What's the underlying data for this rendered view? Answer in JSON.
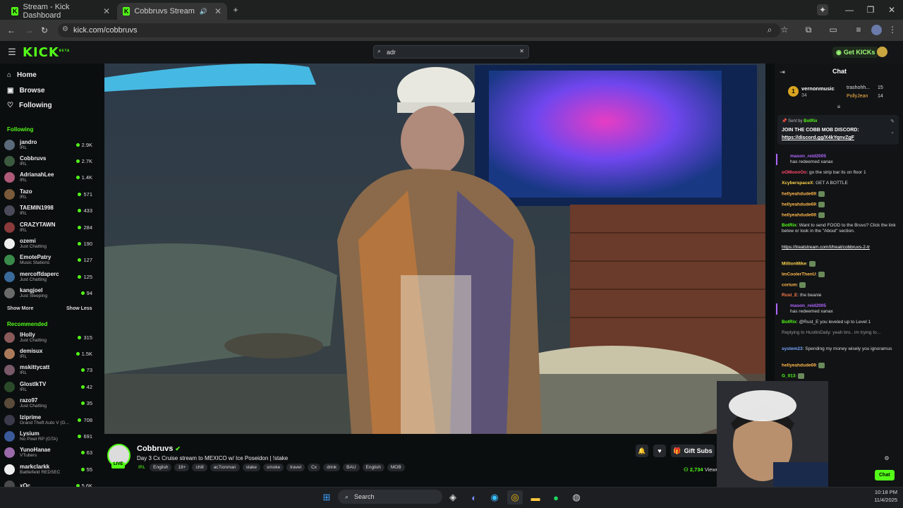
{
  "browser": {
    "tabs": [
      {
        "title": "Stream - Kick Dashboard",
        "active": false
      },
      {
        "title": "Cobbruvs Stream - Watch L",
        "active": true
      }
    ],
    "url": "kick.com/cobbruvs"
  },
  "header": {
    "logo": "KICK",
    "logo_badge": "BETA",
    "search_value": "adr",
    "get_kicks": "Get KICKs"
  },
  "sidebar": {
    "nav": [
      {
        "label": "Home",
        "icon": "home-icon"
      },
      {
        "label": "Browse",
        "icon": "browse-icon"
      },
      {
        "label": "Following",
        "icon": "heart-icon"
      }
    ],
    "following_title": "Following",
    "following": [
      {
        "name": "jandro",
        "category": "IRL",
        "viewers": "2.9K",
        "color": "#5a6a7a"
      },
      {
        "name": "Cobbruvs",
        "category": "IRL",
        "viewers": "2.7K",
        "color": "#3b5a3f"
      },
      {
        "name": "AdrianahLee",
        "category": "IRL",
        "viewers": "1.4K",
        "color": "#b05a7a"
      },
      {
        "name": "Tazo",
        "category": "IRL",
        "viewers": "571",
        "color": "#7a5a3a"
      },
      {
        "name": "TAEMIN1998",
        "category": "IRL",
        "viewers": "433",
        "color": "#4a4a5a"
      },
      {
        "name": "CRAZYTAWN",
        "category": "IRL",
        "viewers": "284",
        "color": "#8a3a3a"
      },
      {
        "name": "ozemi",
        "category": "Just Chatting",
        "viewers": "190",
        "color": "#eeeeee"
      },
      {
        "name": "EmotePatry",
        "category": "Music Stations",
        "viewers": "127",
        "color": "#3a8a4a"
      },
      {
        "name": "mercoffdaperc",
        "category": "Just Chatting",
        "viewers": "125",
        "color": "#3a6a9a"
      },
      {
        "name": "kangjoel",
        "category": "Just Sleeping",
        "viewers": "94",
        "color": "#6a6a6a"
      }
    ],
    "show_more": "Show More",
    "show_less": "Show Less",
    "recommended_title": "Recommended",
    "recommended": [
      {
        "name": "lHolly",
        "category": "Just Chatting",
        "viewers": "315",
        "color": "#8a5a5a"
      },
      {
        "name": "demisux",
        "category": "IRL",
        "viewers": "1.5K",
        "color": "#aa7a5a"
      },
      {
        "name": "mskittycatt",
        "category": "IRL",
        "viewers": "73",
        "color": "#7a5a6a"
      },
      {
        "name": "GlostlkTV",
        "category": "IRL",
        "viewers": "42",
        "color": "#2a4a2a"
      },
      {
        "name": "razo97",
        "category": "Just Chatting",
        "viewers": "35",
        "color": "#5a4a3a"
      },
      {
        "name": "Iziprime",
        "category": "Grand Theft Auto V (G...",
        "viewers": "708",
        "color": "#3a3a4a"
      },
      {
        "name": "Lysium",
        "category": "No Pixel RP (GTA)",
        "viewers": "691",
        "color": "#3a5a9a"
      },
      {
        "name": "YunoHanae",
        "category": "VTubers",
        "viewers": "63",
        "color": "#9a6aaa"
      },
      {
        "name": "markclarkk",
        "category": "Battlefield REDSEC",
        "viewers": "55",
        "color": "#eeeeee"
      },
      {
        "name": "xQc",
        "category": "",
        "viewers": "5.6K",
        "color": "#4a4a4a"
      }
    ]
  },
  "stream": {
    "channel": "Cobbruvs",
    "title": "Day 3 Cx Cruise stream to MEXICO w/ Ice Poseidon | !stake",
    "category": "IRL",
    "tags": [
      "English",
      "18+",
      "chill",
      "ac7ionman",
      "stake",
      "smoke",
      "travel",
      "Cx",
      "drink",
      "BAU",
      "English",
      "MOB"
    ],
    "viewers": "2,734",
    "viewers_suffix": "Viewers",
    "gift_subs": "Gift Subs",
    "live_badge": "LIVE"
  },
  "chat": {
    "title": "Chat",
    "top_gifters": [
      {
        "name": "vernonmusic",
        "count": "34"
      },
      {
        "name": "trashohh...",
        "count": "15"
      },
      {
        "name": "PollyJean",
        "count": "14"
      }
    ],
    "pinned": {
      "sent_by": "Sent by",
      "sender": "BotRix",
      "text": "JOIN THE COBB MOB DISCORD:",
      "link": "https://discord.gg/X4kYqnvZgF"
    },
    "messages": [
      {
        "user": "mason_reid2005",
        "text": "has redeemed xanax",
        "user_color": "#b066ff",
        "redeem": true
      },
      {
        "user": "oOMoonOo",
        "text": "go the strip bar its on floor 1",
        "user_color": "#ff4a6a"
      },
      {
        "user": "XcyberspaceX",
        "text": "GET A BOTTLE",
        "user_color": "#ffd24a"
      },
      {
        "user": "hellyeahdude69",
        "text": "",
        "user_color": "#ffb84a"
      },
      {
        "user": "hellyeahdude69",
        "text": "",
        "user_color": "#ffb84a"
      },
      {
        "user": "hellyeahdude69",
        "text": "",
        "user_color": "#ffb84a"
      },
      {
        "user": "BotRix",
        "text": "Want to send FOOD to the Bruvs? Click the link below or look in the \"About\" section.",
        "user_color": "#53fc18"
      },
      {
        "user": "",
        "text": "https://treatstream.com/t/treat/cobbruvs-2-tr",
        "user_color": "#ffffff",
        "link": true
      },
      {
        "user": "MillionMike",
        "text": "",
        "user_color": "#ffd24a"
      },
      {
        "user": "ImCoolerThenU",
        "text": "",
        "user_color": "#ffb84a"
      },
      {
        "user": "corium",
        "text": "",
        "user_color": "#ffb84a"
      },
      {
        "user": "Rust_E",
        "text": "the beanie",
        "user_color": "#ff7a4a"
      },
      {
        "user": "mason_reid2005",
        "text": "has redeemed xanax",
        "user_color": "#b066ff",
        "redeem": true
      },
      {
        "user": "BotRix",
        "text": "@Rust_E you leveled up to Level 1",
        "user_color": "#53fc18"
      },
      {
        "user": "",
        "text": "Replying to HustlinDaily: yeah bro.. im trying to...",
        "user_color": "#999999",
        "reply": true
      },
      {
        "user": "system23",
        "text": "Spending my money wisely you ignoramus",
        "user_color": "#7aa6ff"
      },
      {
        "user": "hellyeahdude69",
        "text": "",
        "user_color": "#ffb84a"
      },
      {
        "user": "G_013",
        "text": "",
        "user_color": "#53fc18"
      }
    ],
    "send_label": "Chat"
  },
  "taskbar": {
    "search_label": "Search",
    "time": "10:18 PM",
    "date": "11/4/2025"
  }
}
